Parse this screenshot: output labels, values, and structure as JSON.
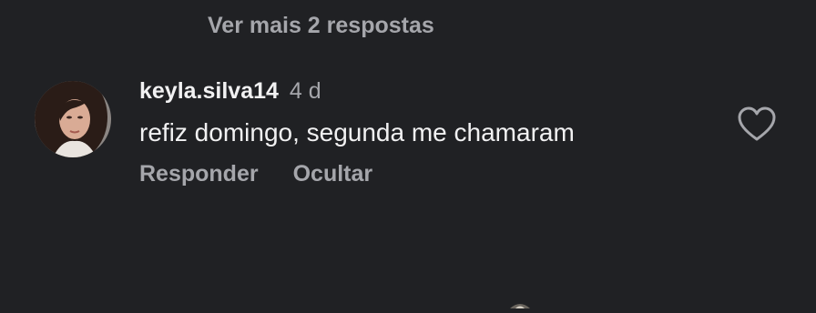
{
  "thread": {
    "more_replies_label": "Ver mais 2 respostas"
  },
  "comment": {
    "username": "keyla.silva14",
    "time_ago": "4 d",
    "text": "refiz domingo, segunda me chamaram",
    "avatar_icon": "user-avatar-photo",
    "like_icon": "heart-outline-icon",
    "actions": {
      "reply_label": "Responder",
      "hide_label": "Ocultar"
    }
  },
  "colors": {
    "background": "#202124",
    "primary_text": "#f1f1f2",
    "secondary_text": "#a5a6ab"
  }
}
